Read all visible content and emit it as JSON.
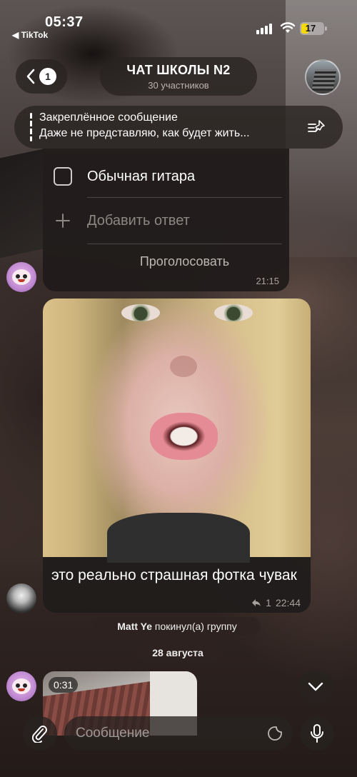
{
  "status_bar": {
    "time": "05:37",
    "back_app": "◀ TikTok",
    "battery": "17"
  },
  "header": {
    "back_count": "1",
    "title": "ЧАТ ШКОЛЫ N2",
    "subtitle": "30 участников"
  },
  "pinned": {
    "label": "Закреплённое сообщение",
    "text": "Даже не представляю, как будет жить..."
  },
  "poll": {
    "option": "Обычная гитара",
    "add_answer": "Добавить ответ",
    "vote": "Проголосовать",
    "time": "21:15"
  },
  "photo_message": {
    "caption": "это реально страшная фотка чувак",
    "replies": "1",
    "time": "22:44"
  },
  "service": {
    "left_user": "Matt Ye",
    "left_text": "покинул(а) группу",
    "date": "28 августа"
  },
  "video": {
    "duration": "0:31"
  },
  "input": {
    "placeholder": "Сообщение"
  },
  "colors": {
    "battery": "#f5d90a",
    "bubble": "#201c1b"
  }
}
